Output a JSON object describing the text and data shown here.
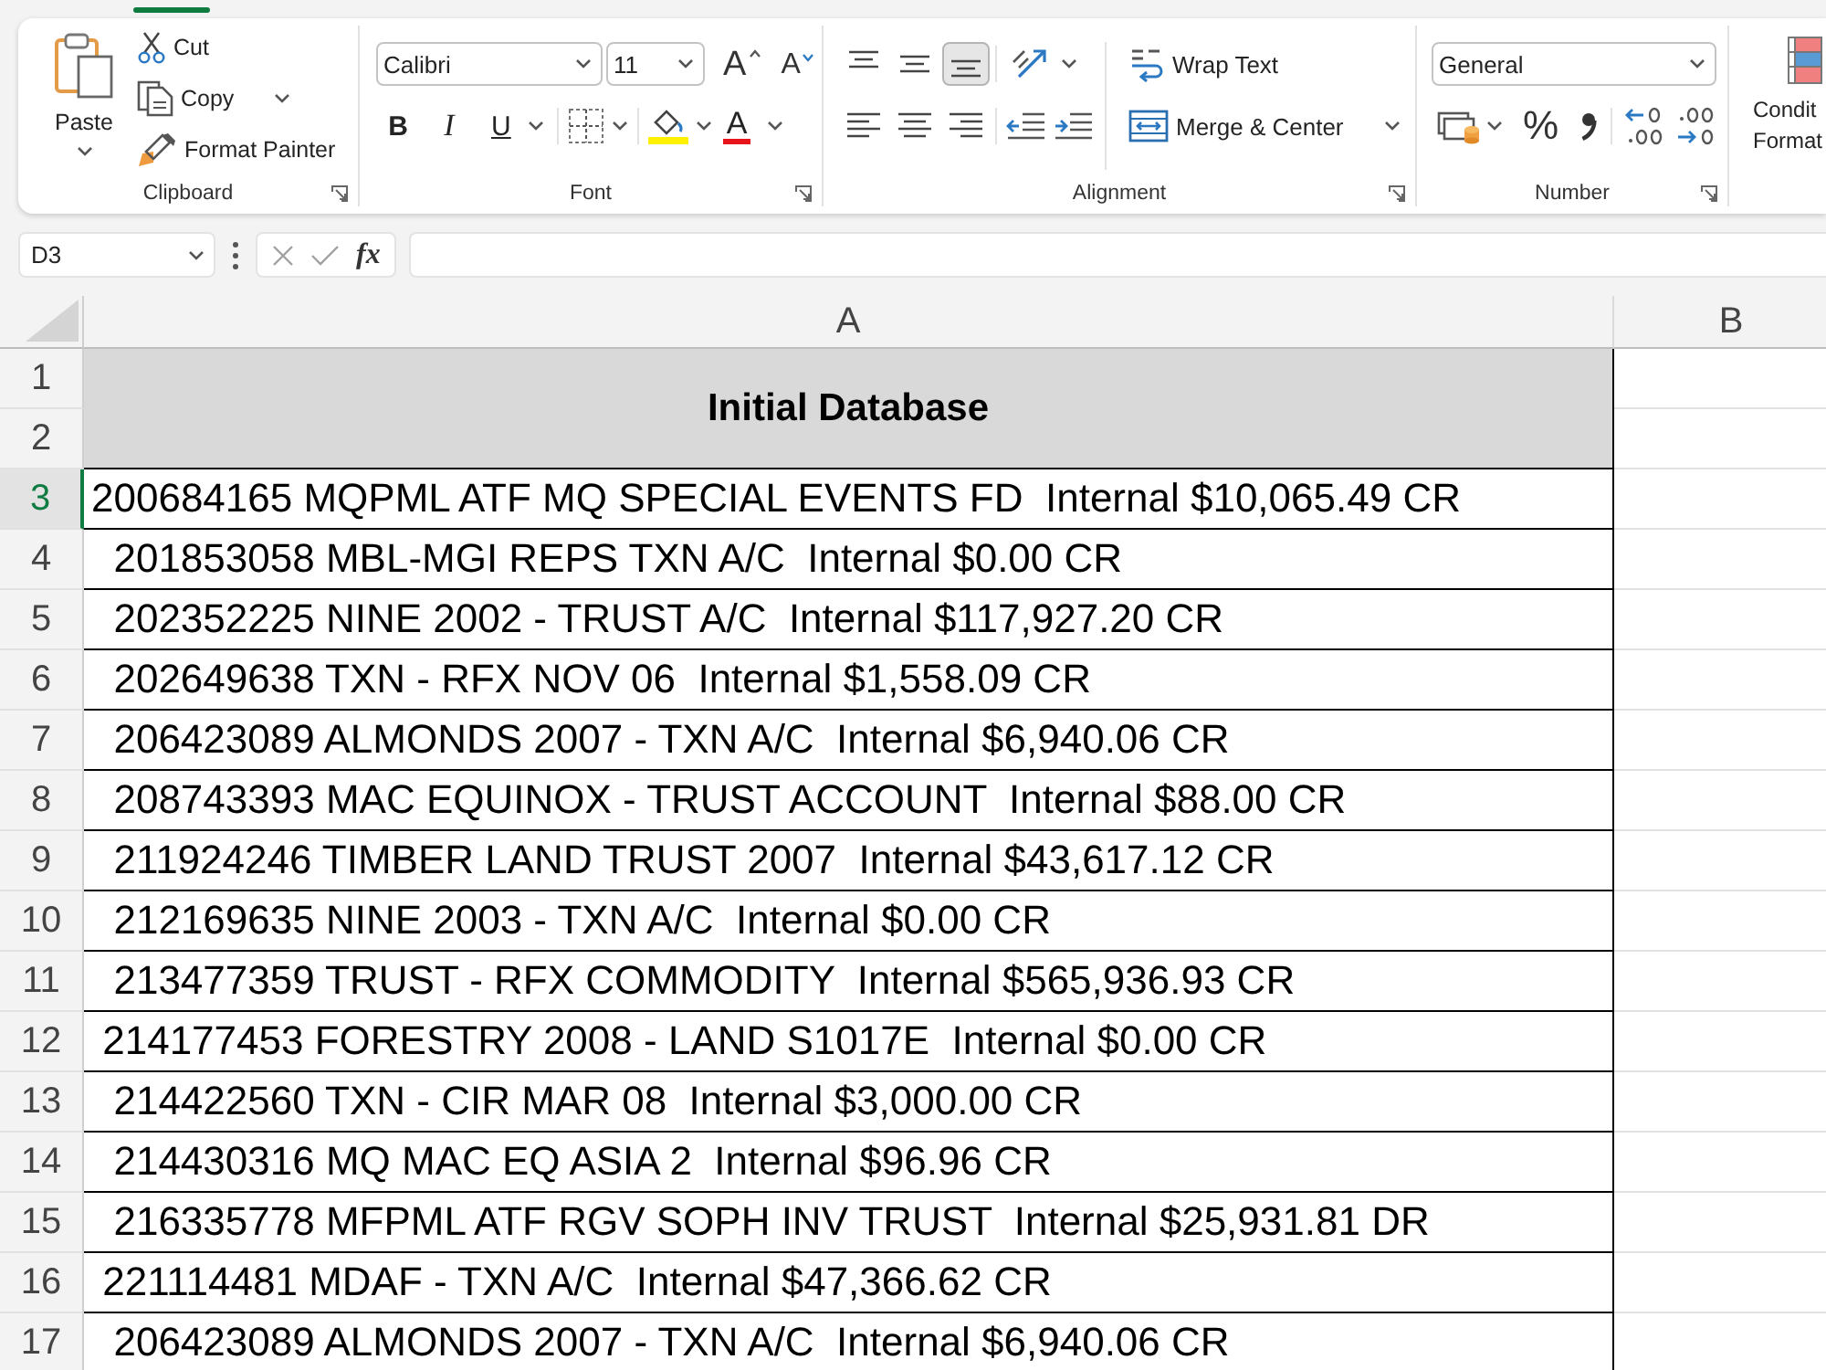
{
  "clipboard": {
    "label": "Clipboard",
    "paste": "Paste",
    "cut": "Cut",
    "copy": "Copy",
    "format_painter": "Format Painter"
  },
  "font": {
    "label": "Font",
    "name": "Calibri",
    "size": "11",
    "grow": "A",
    "shrink": "A",
    "bold": "B",
    "italic": "I",
    "underline": "U",
    "text_color_button": "A"
  },
  "alignment": {
    "label": "Alignment",
    "vertical_align": [
      {
        "kind": "top",
        "selected": false
      },
      {
        "kind": "middle",
        "selected": false
      },
      {
        "kind": "bottom",
        "selected": true
      }
    ],
    "wrap_text": "Wrap Text",
    "merge": "Merge & Center"
  },
  "number": {
    "label": "Number",
    "format": "General",
    "percent": "%"
  },
  "styles": {
    "conditional_formatting": [
      "Condit",
      "Format"
    ]
  },
  "formula_bar": {
    "name_box": "D3",
    "function": "fx"
  },
  "sheet": {
    "columns": [
      "A",
      "B"
    ],
    "title": "Initial Database",
    "rows": [
      {
        "number": "1",
        "selected": false
      },
      {
        "number": "2",
        "selected": false
      },
      {
        "number": "3",
        "selected": true,
        "value": "200684165 MQPML ATF MQ SPECIAL EVENTS FD  Internal $10,065.49 CR"
      },
      {
        "number": "4",
        "selected": false,
        "value": "  201853058 MBL-MGI REPS TXN A/C  Internal $0.00 CR"
      },
      {
        "number": "5",
        "selected": false,
        "value": "  202352225 NINE 2002 - TRUST A/C  Internal $117,927.20 CR"
      },
      {
        "number": "6",
        "selected": false,
        "value": "  202649638 TXN - RFX NOV 06  Internal $1,558.09 CR"
      },
      {
        "number": "7",
        "selected": false,
        "value": "  206423089 ALMONDS 2007 - TXN A/C  Internal $6,940.06 CR"
      },
      {
        "number": "8",
        "selected": false,
        "value": "  208743393 MAC EQUINOX - TRUST ACCOUNT  Internal $88.00 CR"
      },
      {
        "number": "9",
        "selected": false,
        "value": "  211924246 TIMBER LAND TRUST 2007  Internal $43,617.12 CR"
      },
      {
        "number": "10",
        "selected": false,
        "value": "  212169635 NINE 2003 - TXN A/C  Internal $0.00 CR"
      },
      {
        "number": "11",
        "selected": false,
        "value": "  213477359 TRUST - RFX COMMODITY  Internal $565,936.93 CR"
      },
      {
        "number": "12",
        "selected": false,
        "value": " 214177453 FORESTRY 2008 - LAND S1017E  Internal $0.00 CR"
      },
      {
        "number": "13",
        "selected": false,
        "value": "  214422560 TXN - CIR MAR 08  Internal $3,000.00 CR"
      },
      {
        "number": "14",
        "selected": false,
        "value": "  214430316 MQ MAC EQ ASIA 2  Internal $96.96 CR"
      },
      {
        "number": "15",
        "selected": false,
        "value": "  216335778 MFPML ATF RGV SOPH INV TRUST  Internal $25,931.81 DR"
      },
      {
        "number": "16",
        "selected": false,
        "value": " 221114481 MDAF - TXN A/C  Internal $47,366.62 CR"
      },
      {
        "number": "17",
        "selected": false,
        "value": "  206423089 ALMONDS 2007 - TXN A/C  Internal $6,940.06 CR"
      }
    ]
  }
}
